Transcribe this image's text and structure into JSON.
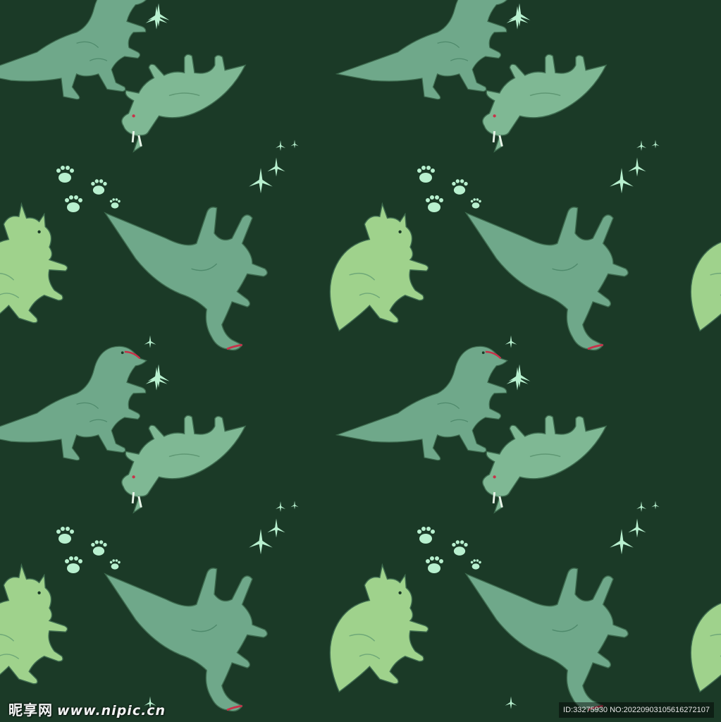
{
  "watermark": {
    "brand": "昵享网",
    "url": "www.nipic.cn",
    "id_text": "ID:33275930 NO:20220903105616272107"
  },
  "colors": {
    "background": "#1b3a27",
    "trex": "#6fa88a",
    "triceratops_light": "#9fd28c",
    "triceratops_mid": "#7fb894",
    "footprint": "#b8f0cf",
    "mouth": "#c8324a",
    "outline": "#3e6b4f"
  },
  "icons": [
    "trex-icon",
    "triceratops-icon",
    "footprint-icon",
    "bird-track-icon"
  ]
}
